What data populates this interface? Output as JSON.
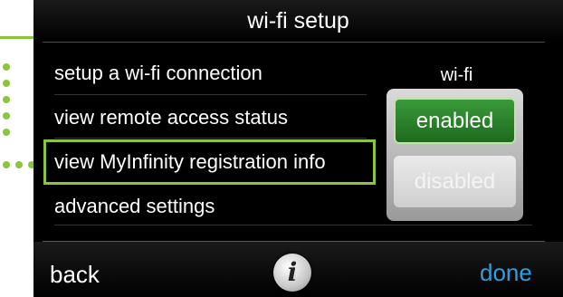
{
  "header": {
    "title": "wi-fi setup"
  },
  "menu": {
    "items": [
      {
        "label": "setup a wi-fi connection"
      },
      {
        "label": "view remote access status"
      },
      {
        "label": "view MyInfinity registration info"
      },
      {
        "label": "advanced settings"
      }
    ]
  },
  "wifi_toggle": {
    "label": "wi-fi",
    "enabled_label": "enabled",
    "disabled_label": "disabled",
    "selected": "enabled"
  },
  "footer": {
    "back_label": "back",
    "info_icon": "i",
    "done_label": "done"
  },
  "colors": {
    "callout": "#8cc43d",
    "enabled": "#2a8a2a",
    "done": "#2f9fe2"
  },
  "icons": [
    "info-icon"
  ]
}
